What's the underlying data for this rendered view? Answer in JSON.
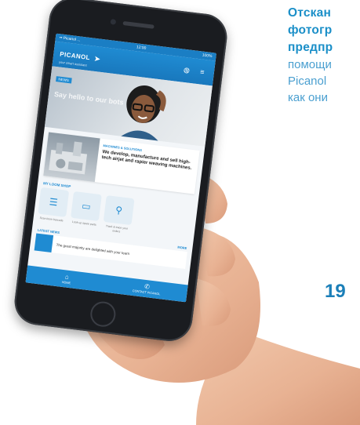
{
  "side_text": {
    "line1": "Отскан",
    "line2": "фотогр",
    "line3": "предпр",
    "line4": "помощи",
    "line5": "Picanol",
    "line6": "как они"
  },
  "page_number": "19",
  "phone": {
    "status": {
      "left": "•• Picanol ...",
      "time": "12:00",
      "right": "100%"
    },
    "app_title": "PICANOL",
    "app_subtitle": "your smart assistant",
    "hero": {
      "tag": "NEWS",
      "text": "Say hello to our bots"
    },
    "card": {
      "title": "MACHINES & SOLUTIONS",
      "body": "We develop, manufacture and sell high-tech airjet and rapier weaving machines."
    },
    "section_title": "MY LOOM SHOP",
    "tiles": [
      {
        "icon": "☰",
        "label": "Scan loom barcode"
      },
      {
        "icon": "▭",
        "label": "Look up spare parts"
      },
      {
        "icon": "⚲",
        "label": "Track & trace your orders"
      }
    ],
    "news_header": {
      "left": "LATEST NEWS",
      "right": "MORE"
    },
    "news_item": "The great majority are delighted with your team",
    "tabs": [
      {
        "icon": "⌂",
        "label": "HOME"
      },
      {
        "icon": "✆",
        "label": "CONTACT PICANOL"
      }
    ]
  },
  "colors": {
    "accent": "#1f8bd2",
    "text_blue": "#1b8fc8"
  }
}
